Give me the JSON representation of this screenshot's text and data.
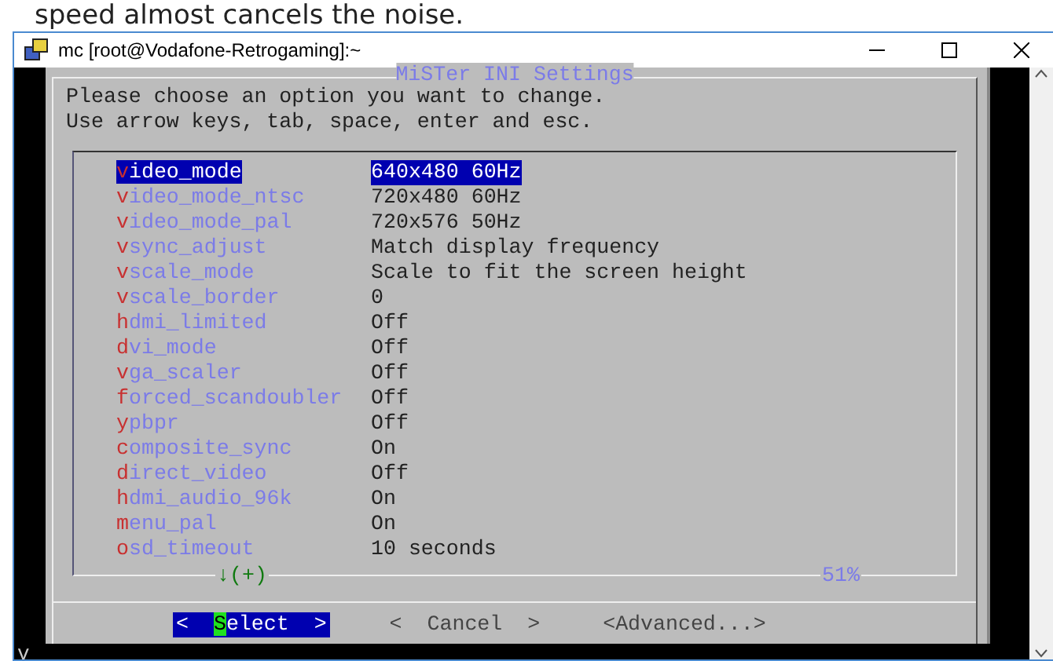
{
  "caption": "speed almost cancels the noise.",
  "window": {
    "title": "mc [root@Vodafone-Retrogaming]:~"
  },
  "dialog": {
    "title": "MiSTer INI Settings",
    "prompt": [
      "Please choose an option you want to change.",
      "Use arrow keys, tab, space, enter and esc."
    ],
    "items": [
      {
        "key": "video_mode",
        "value": "640x480 60Hz",
        "selected": true
      },
      {
        "key": "video_mode_ntsc",
        "value": "720x480 60Hz",
        "selected": false
      },
      {
        "key": "video_mode_pal",
        "value": "720x576 50Hz",
        "selected": false
      },
      {
        "key": "vsync_adjust",
        "value": "Match display frequency",
        "selected": false
      },
      {
        "key": "vscale_mode",
        "value": "Scale to fit the screen height",
        "selected": false
      },
      {
        "key": "vscale_border",
        "value": "0",
        "selected": false
      },
      {
        "key": "hdmi_limited",
        "value": "Off",
        "selected": false
      },
      {
        "key": "dvi_mode",
        "value": "Off",
        "selected": false
      },
      {
        "key": "vga_scaler",
        "value": "Off",
        "selected": false
      },
      {
        "key": "forced_scandoubler",
        "value": "Off",
        "selected": false
      },
      {
        "key": "ypbpr",
        "value": "Off",
        "selected": false
      },
      {
        "key": "composite_sync",
        "value": "On",
        "selected": false
      },
      {
        "key": "direct_video",
        "value": "Off",
        "selected": false
      },
      {
        "key": "hdmi_audio_96k",
        "value": "On",
        "selected": false
      },
      {
        "key": "menu_pal",
        "value": "On",
        "selected": false
      },
      {
        "key": "osd_timeout",
        "value": "10 seconds",
        "selected": false
      }
    ],
    "scroll_indicator": "↓(+)",
    "scroll_percent": "51%",
    "buttons": [
      {
        "kind": "bracketed",
        "open": "<",
        "label": "Select",
        "close": ">",
        "selected": true
      },
      {
        "kind": "bracketed",
        "open": "<",
        "label": "Cancel",
        "close": ">",
        "selected": false
      },
      {
        "kind": "plain",
        "label": "<Advanced...>",
        "selected": false
      }
    ]
  },
  "terminal_fragment": "v"
}
